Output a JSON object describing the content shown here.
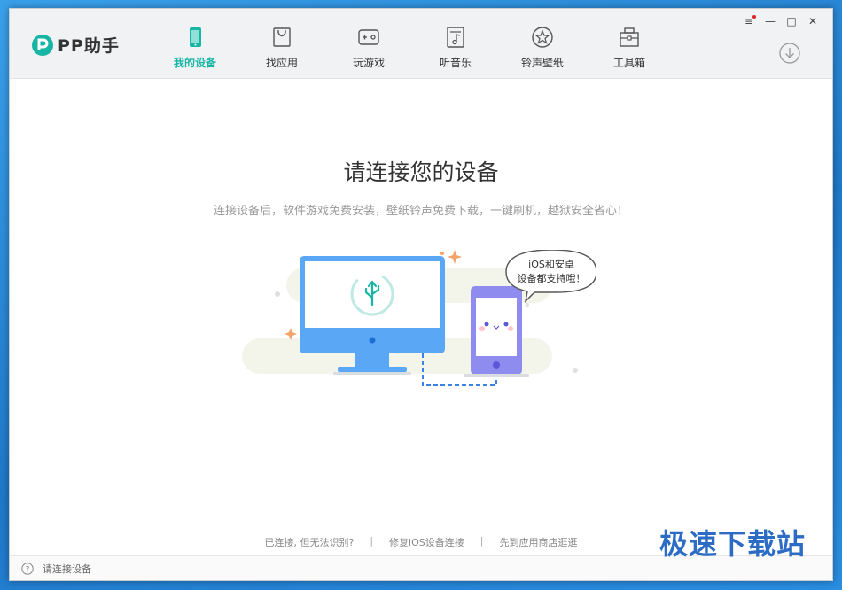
{
  "app": {
    "name": "PP助手"
  },
  "nav": {
    "items": [
      {
        "label": "我的设备",
        "icon": "device-icon",
        "active": true
      },
      {
        "label": "找应用",
        "icon": "app-bag-icon",
        "active": false
      },
      {
        "label": "玩游戏",
        "icon": "gamepad-icon",
        "active": false
      },
      {
        "label": "听音乐",
        "icon": "music-icon",
        "active": false
      },
      {
        "label": "铃声壁纸",
        "icon": "star-icon",
        "active": false
      },
      {
        "label": "工具箱",
        "icon": "toolbox-icon",
        "active": false
      }
    ]
  },
  "window_controls": [
    "menu-icon",
    "minimize-icon",
    "maximize-icon",
    "close-icon"
  ],
  "main": {
    "title": "请连接您的设备",
    "subtitle": "连接设备后，软件游戏免费安装，壁纸铃声免费下载，一键刷机，越狱安全省心！",
    "bubble_line1": "iOS和安卓",
    "bubble_line2": "设备都支持哦！"
  },
  "links": {
    "unrecognized": "已连接, 但无法识别?",
    "repair_ios": "修复iOS设备连接",
    "app_store": "先到应用商店逛逛",
    "separator": "|"
  },
  "status": {
    "text": "请连接设备"
  },
  "watermark": "极速下载站",
  "colors": {
    "accent": "#17b5a4",
    "monitor": "#5aa8f5",
    "phone": "#8f8cf0"
  }
}
